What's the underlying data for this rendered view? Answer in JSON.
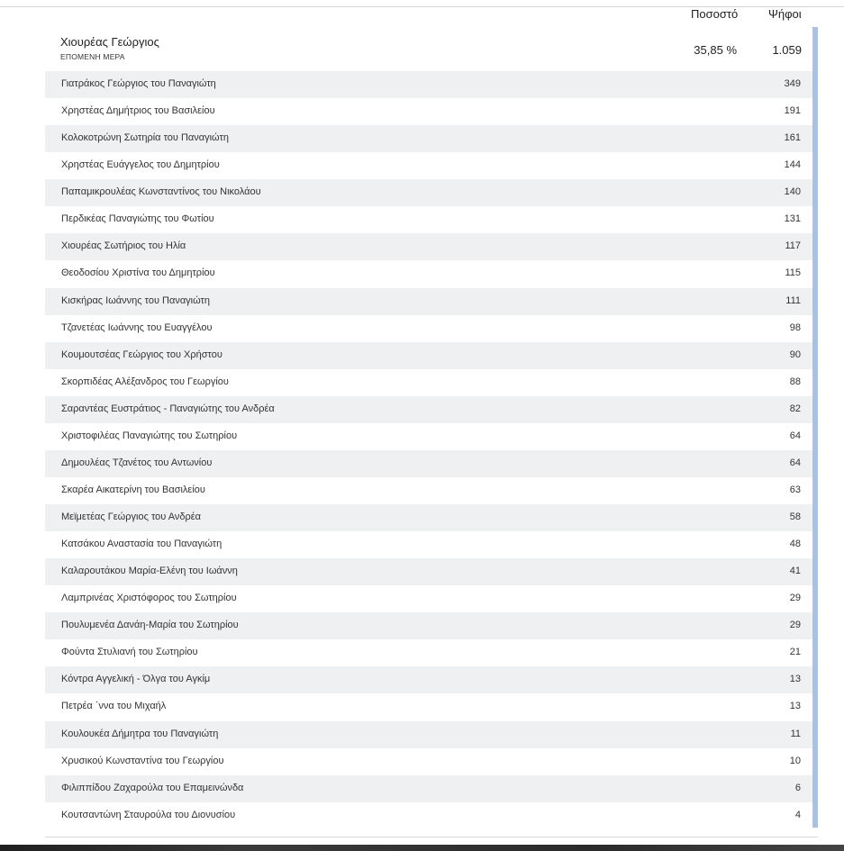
{
  "header": {
    "percent_label": "Ποσοστό",
    "votes_label": "Ψήφοι"
  },
  "candidate": {
    "name": "Χιουρέας Γεώργιος",
    "party": "ΕΠΟΜΕΝΗ ΜΕΡΑ",
    "percent": "35,85 %",
    "votes": "1.059"
  },
  "rows": [
    {
      "name": "Γιατράκος Γεώργιος του Παναγιώτη",
      "votes": "349"
    },
    {
      "name": "Χρηστέας Δημήτριος του Βασιλείου",
      "votes": "191"
    },
    {
      "name": "Κολοκοτρώνη Σωτηρία του Παναγιώτη",
      "votes": "161"
    },
    {
      "name": "Χρηστέας Ευάγγελος του Δημητρίου",
      "votes": "144"
    },
    {
      "name": "Παπαμικρουλέας Κωνσταντίνος του Νικολάου",
      "votes": "140"
    },
    {
      "name": "Περδικέας Παναγιώτης του Φωτίου",
      "votes": "131"
    },
    {
      "name": "Χιουρέας Σωτήριος του Ηλία",
      "votes": "117"
    },
    {
      "name": "Θεοδοσίου Χριστίνα του Δημητρίου",
      "votes": "115"
    },
    {
      "name": "Κισκήρας Ιωάννης του Παναγιώτη",
      "votes": "111"
    },
    {
      "name": "Τζανετέας Ιωάννης του Ευαγγέλου",
      "votes": "98"
    },
    {
      "name": "Κουμουτσέας Γεώργιος του Χρήστου",
      "votes": "90"
    },
    {
      "name": "Σκορπιδέας Αλέξανδρος του Γεωργίου",
      "votes": "88"
    },
    {
      "name": "Σαραντέας Ευστράτιος - Παναγιώτης του Ανδρέα",
      "votes": "82"
    },
    {
      "name": "Χριστοφιλέας Παναγιώτης του Σωτηρίου",
      "votes": "64"
    },
    {
      "name": "Δημουλέας Τζανέτος του Αντωνίου",
      "votes": "64"
    },
    {
      "name": "Σκαρέα Αικατερίνη του Βασιλείου",
      "votes": "63"
    },
    {
      "name": "Μεϊμετέας Γεώργιος του Ανδρέα",
      "votes": "58"
    },
    {
      "name": "Κατσάκου Αναστασία του Παναγιώτη",
      "votes": "48"
    },
    {
      "name": "Καλαρουτάκου Μαρία-Ελένη του Ιωάννη",
      "votes": "41"
    },
    {
      "name": "Λαμπρινέας Χριστόφορος του Σωτηρίου",
      "votes": "29"
    },
    {
      "name": "Πουλυμενέα Δανάη-Μαρία του Σωτηρίου",
      "votes": "29"
    },
    {
      "name": "Φούντα Στυλιανή του Σωτηρίου",
      "votes": "21"
    },
    {
      "name": "Κόντρα Αγγελική - Όλγα του Αγκίμ",
      "votes": "13"
    },
    {
      "name": "Πετρέα ΄ννα του Μιχαήλ",
      "votes": "13"
    },
    {
      "name": "Κουλουκέα Δήμητρα του Παναγιώτη",
      "votes": "11"
    },
    {
      "name": "Χρυσικού Κωνσταντίνα του Γεωργίου",
      "votes": "10"
    },
    {
      "name": "Φιλιππίδου Ζαχαρούλα του Επαμεινώνδα",
      "votes": "6"
    },
    {
      "name": "Κουτσαντώνη Σταυρούλα του Διονυσίου",
      "votes": "4"
    }
  ]
}
